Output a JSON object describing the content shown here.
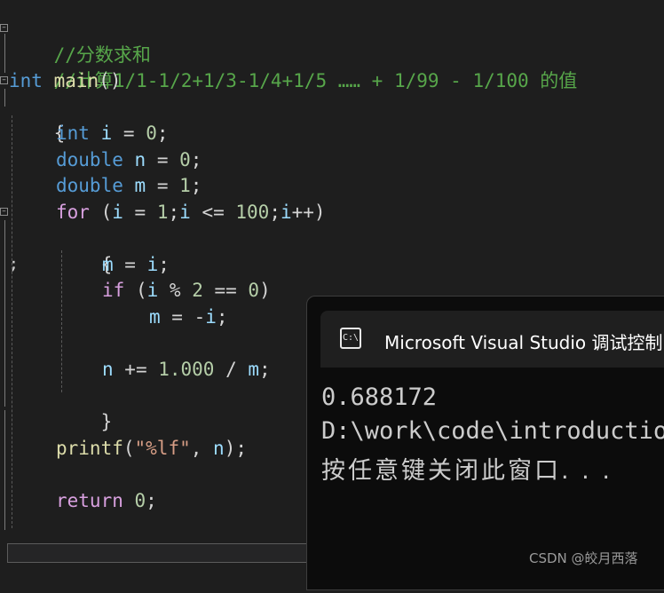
{
  "code": {
    "comment1": "//分数求和",
    "comment2": "//计算1/1-1/2+1/3-1/4+1/5 …… + 1/99 - 1/100 的值",
    "main_sig": {
      "type": "int",
      "name": "main",
      "parens": "()"
    },
    "brace_open": "{",
    "brace_close": "}",
    "decl_i": {
      "type": "int",
      "var": "i",
      "op": " = ",
      "num": "0",
      "end": ";"
    },
    "decl_n": {
      "type": "double",
      "var": "n",
      "op": " = ",
      "num": "0",
      "end": ";"
    },
    "decl_m": {
      "type": "double",
      "var": "m",
      "op": " = ",
      "num": "1",
      "end": ";"
    },
    "for_line": {
      "kw": "for",
      "p1": " (",
      "v1": "i",
      "o1": " = ",
      "n1": "1",
      "o2": ";",
      "v2": "i",
      "o3": " <= ",
      "n2": "100",
      "o4": ";",
      "v3": "i",
      "o5": "++)"
    },
    "inner_open": "{",
    "inner_close": "}",
    "assign_m": {
      "var": "m",
      "op": " = ",
      "var2": "i",
      "end": ";"
    },
    "if_line": {
      "kw": "if",
      "p1": " (",
      "v1": "i",
      "o1": " % ",
      "n1": "2",
      "o2": " == ",
      "n2": "0",
      "o3": ")"
    },
    "neg_m": {
      "var": "m",
      "op": " = -",
      "var2": "i",
      "end": ";"
    },
    "accum": {
      "var": "n",
      "op": " += ",
      "num": "1.000",
      "op2": " / ",
      "var2": "m",
      "end": ";"
    },
    "printf": {
      "func": "printf",
      "p1": "(",
      "str": "\"%lf\"",
      "comma": ", ",
      "var": "n",
      "end": ");"
    },
    "ret": {
      "kw": "return",
      "sp": " ",
      "num": "0",
      "end": ";"
    },
    "margin_semicolon": ";"
  },
  "console": {
    "title": "Microsoft Visual Studio 调试控制台",
    "output_value": "0.688172",
    "output_path": "D:\\work\\code\\introduction",
    "prompt": "按任意键关闭此窗口. . .",
    "icon_glyph": "C:\\"
  },
  "watermark": "CSDN @皎月西落",
  "colors": {
    "background": "#1e1e1e",
    "comment": "#57a64a",
    "keyword": "#569cd6",
    "control": "#d8a0df",
    "function": "#dcdcaa",
    "variable": "#9cdcfe",
    "number": "#b5cea8",
    "string": "#d69d85",
    "console_bg": "#0c0c0c"
  }
}
